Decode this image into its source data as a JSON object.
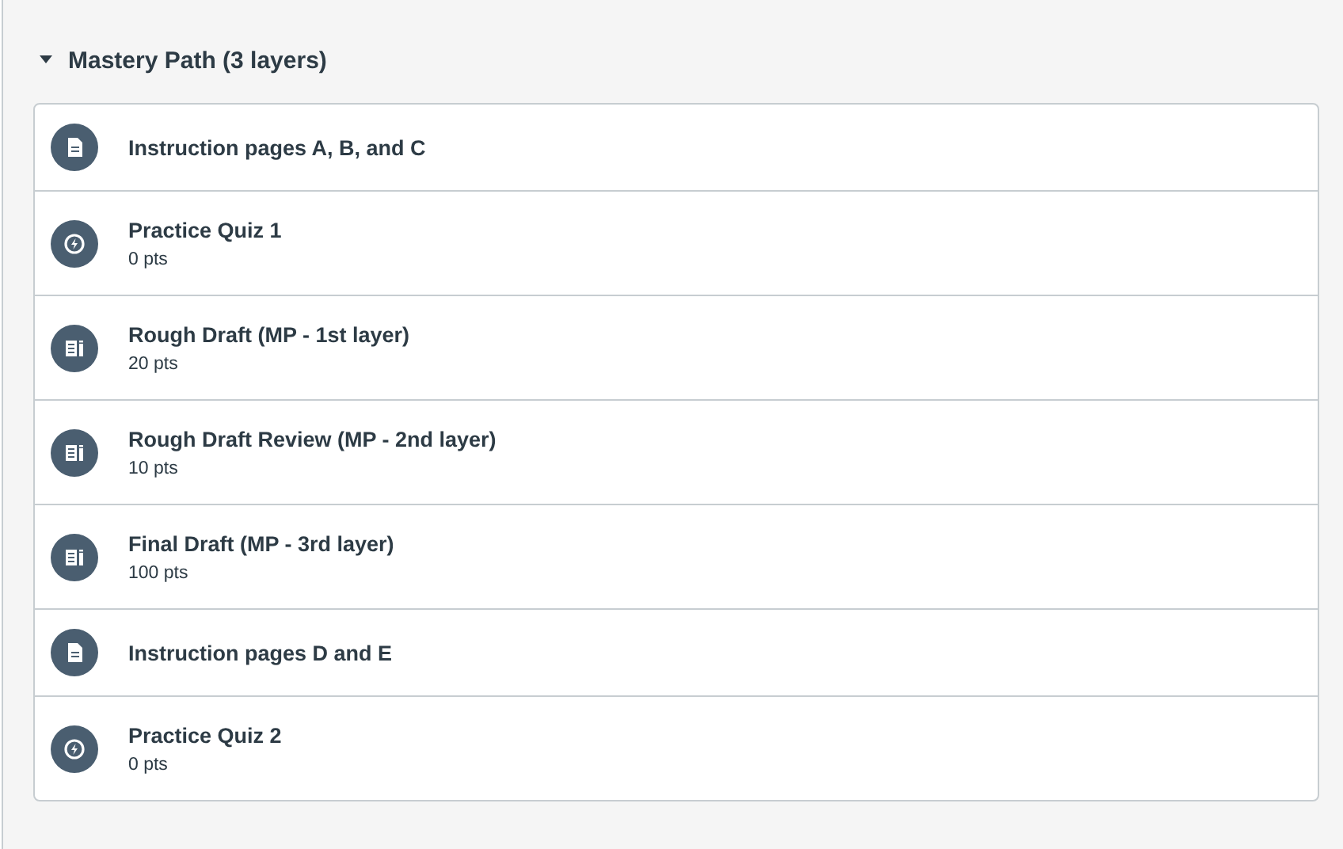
{
  "section": {
    "title": "Mastery Path (3 layers)",
    "expanded": true
  },
  "items": [
    {
      "kind": "page",
      "title": "Instruction pages A, B, and C"
    },
    {
      "kind": "quiz",
      "title": "Practice Quiz 1",
      "points": "0 pts"
    },
    {
      "kind": "assignment",
      "title": "Rough Draft (MP - 1st layer)",
      "points": "20 pts"
    },
    {
      "kind": "assignment",
      "title": "Rough Draft Review (MP - 2nd layer)",
      "points": "10 pts"
    },
    {
      "kind": "assignment",
      "title": "Final Draft (MP - 3rd layer)",
      "points": "100 pts"
    },
    {
      "kind": "page",
      "title": "Instruction pages D and E"
    },
    {
      "kind": "quiz",
      "title": "Practice Quiz 2",
      "points": "0 pts"
    }
  ]
}
